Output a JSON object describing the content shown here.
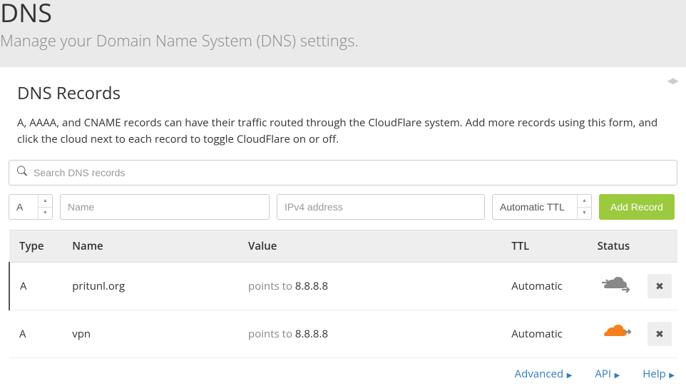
{
  "header": {
    "title": "DNS",
    "subtitle": "Manage your Domain Name System (DNS) settings."
  },
  "panel": {
    "title": "DNS Records",
    "description": "A, AAAA, and CNAME records can have their traffic routed through the CloudFlare system. Add more records using this form, and click the cloud next to each record to toggle CloudFlare on or off."
  },
  "search": {
    "placeholder": "Search DNS records"
  },
  "form": {
    "type_value": "A",
    "name_placeholder": "Name",
    "value_placeholder": "IPv4 address",
    "ttl_value": "Automatic TTL",
    "add_button": "Add Record"
  },
  "table": {
    "headers": {
      "type": "Type",
      "name": "Name",
      "value": "Value",
      "ttl": "TTL",
      "status": "Status"
    },
    "rows": [
      {
        "type": "A",
        "name": "pritunl.org",
        "prefix": "points to ",
        "target": "8.8.8.8",
        "ttl": "Automatic",
        "proxied": false
      },
      {
        "type": "A",
        "name": "vpn",
        "prefix": "points to ",
        "target": "8.8.8.8",
        "ttl": "Automatic",
        "proxied": true
      }
    ]
  },
  "footer": {
    "advanced": "Advanced",
    "api": "API",
    "help": "Help"
  },
  "colors": {
    "grey_cloud": "#888888",
    "orange_cloud": "#f38020"
  }
}
